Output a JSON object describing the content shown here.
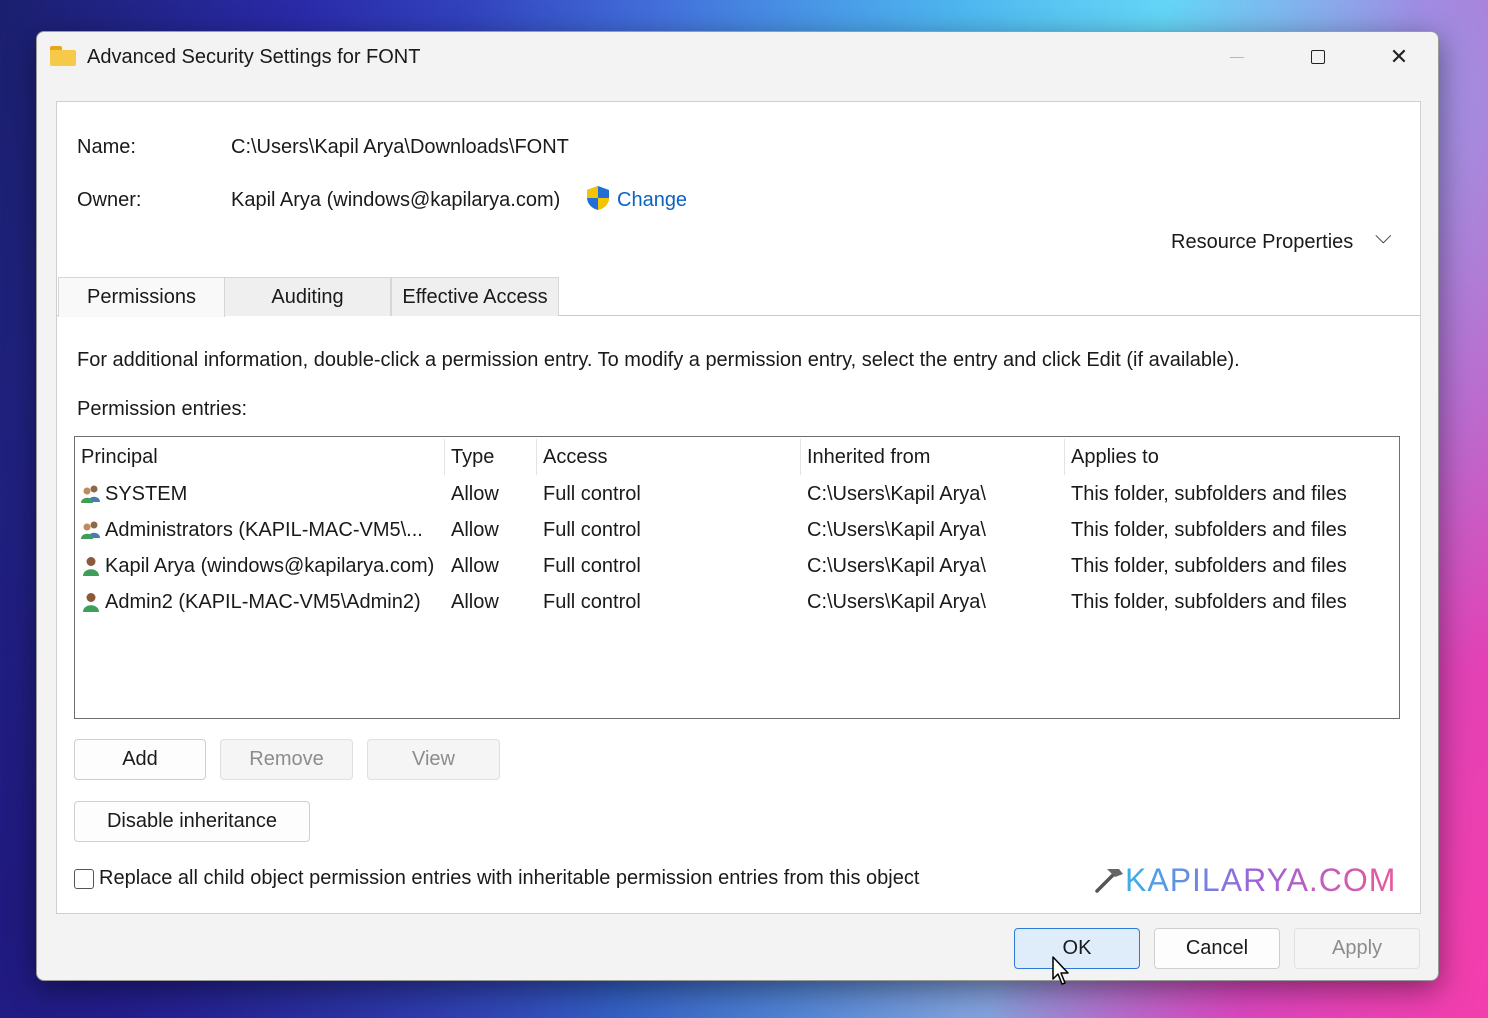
{
  "window": {
    "title": "Advanced Security Settings for FONT",
    "close_glyph": "✕"
  },
  "info": {
    "name_label": "Name:",
    "name_value": "C:\\Users\\Kapil Arya\\Downloads\\FONT",
    "owner_label": "Owner:",
    "owner_value": "Kapil Arya (windows@kapilarya.com)",
    "change_link": "Change",
    "resource_properties": "Resource Properties",
    "resource_chevron": "⌵"
  },
  "tabs": [
    {
      "label": "Permissions",
      "active": true
    },
    {
      "label": "Auditing",
      "active": false
    },
    {
      "label": "Effective Access",
      "active": false
    }
  ],
  "instructions": "For additional information, double-click a permission entry. To modify a permission entry, select the entry and click Edit (if available).",
  "entries_label": "Permission entries:",
  "table": {
    "columns": [
      "Principal",
      "Type",
      "Access",
      "Inherited from",
      "Applies to"
    ],
    "rows": [
      {
        "principal": "SYSTEM",
        "icon": "group-icon",
        "type": "Allow",
        "access": "Full control",
        "inherited_from": "C:\\Users\\Kapil Arya\\",
        "applies_to": "This folder, subfolders and files"
      },
      {
        "principal": "Administrators (KAPIL-MAC-VM5\\...",
        "icon": "group-icon",
        "type": "Allow",
        "access": "Full control",
        "inherited_from": "C:\\Users\\Kapil Arya\\",
        "applies_to": "This folder, subfolders and files"
      },
      {
        "principal": "Kapil Arya (windows@kapilarya.com)",
        "icon": "user-icon",
        "type": "Allow",
        "access": "Full control",
        "inherited_from": "C:\\Users\\Kapil Arya\\",
        "applies_to": "This folder, subfolders and files"
      },
      {
        "principal": "Admin2 (KAPIL-MAC-VM5\\Admin2)",
        "icon": "user-icon",
        "type": "Allow",
        "access": "Full control",
        "inherited_from": "C:\\Users\\Kapil Arya\\",
        "applies_to": "This folder, subfolders and files"
      }
    ]
  },
  "buttons": {
    "add": "Add",
    "remove": "Remove",
    "view": "View",
    "disable_inheritance": "Disable inheritance",
    "ok": "OK",
    "cancel": "Cancel",
    "apply": "Apply"
  },
  "replace_checkbox": {
    "label": "Replace all child object permission entries with inheritable permission entries from this object",
    "checked": false
  },
  "watermark": "KAPILARYA.COM",
  "colors": {
    "link": "#0a64c2",
    "ok_border": "#2f7ad6",
    "ok_fill": "#dfecfa",
    "shield_blue": "#1f6fd6",
    "shield_yellow": "#f5c400"
  }
}
